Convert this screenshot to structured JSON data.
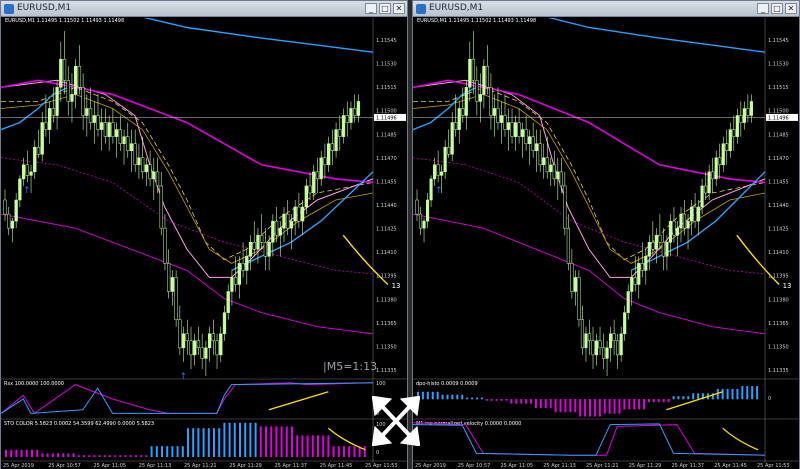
{
  "windows": [
    {
      "title": "EURUSD,M1",
      "header": "EURUSD,M1  1.11495 1.11502 1.11493 1.11498",
      "price_labels": [
        "1.11545",
        "1.11530",
        "1.11515",
        "1.11500",
        "1.11485",
        "1.11470",
        "1.11455",
        "1.11440",
        "1.11425",
        "1.11410",
        "1.11395",
        "1.11380",
        "1.11365",
        "1.11350",
        "1.11335"
      ],
      "current_price": "1.11496",
      "marker": "13",
      "note": "|M5=1:13",
      "panel1": {
        "title": "Rsx 100.0000 100.0000",
        "scale": [
          "100",
          "",
          "0"
        ]
      },
      "panel2": {
        "title": "STO COLOR 5.5823  0.0002 54.3599 62.4990  0.0000  5.5823",
        "scale": [
          "100",
          "50",
          "0"
        ]
      },
      "time_labels": [
        "25 Apr 2019",
        "25 Apr 10:57",
        "25 Apr 11:05",
        "25 Apr 11:13",
        "25 Apr 11:21",
        "25 Apr 11:29",
        "25 Apr 11:37",
        "25 Apr 11:45",
        "25 Apr 11:53"
      ]
    },
    {
      "title": "EURUSD,M1",
      "header": "EURUSD,M1  1.11495 1.11502 1.11493 1.11498",
      "price_labels": [
        "1.11545",
        "1.11530",
        "1.11515",
        "1.11500",
        "1.11485",
        "1.11470",
        "1.11455",
        "1.11440",
        "1.11425",
        "1.11410",
        "1.11395",
        "1.11380",
        "1.11365",
        "1.11350",
        "1.11335"
      ],
      "current_price": "1.11496",
      "marker": "13",
      "panel1": {
        "title": "dpo-histo 0.0009 0.0009",
        "scale": [
          "",
          "0",
          ""
        ]
      },
      "panel2": {
        "title": "M1 rsx normalized velocity 0.0000 0.0000",
        "scale": [
          "",
          "",
          ""
        ]
      },
      "time_labels": [
        "25 Apr 2019",
        "25 Apr 10:57",
        "25 Apr 11:05",
        "25 Apr 11:13",
        "25 Apr 11:21",
        "25 Apr 11:29",
        "25 Apr 11:37",
        "25 Apr 11:45",
        "25 Apr 11:53"
      ]
    }
  ],
  "buttons": {
    "minimize": "_",
    "maximize": "□",
    "close": "✕"
  },
  "colors": {
    "bg": "#000000",
    "candle": "#c8ff9e",
    "blue": "#2aa0ff",
    "magenta": "#e000e0",
    "pink": "#ff9de8",
    "gold": "#c8a000",
    "yellow": "#ffe000",
    "histo_blue": "#2aa0ff",
    "histo_magenta": "#e000e0"
  },
  "candles": [
    [
      0.0,
      0.5,
      0.53,
      0.44,
      0.46
    ],
    [
      0.01,
      0.46,
      0.48,
      0.4,
      0.42
    ],
    [
      0.02,
      0.42,
      0.45,
      0.38,
      0.44
    ],
    [
      0.03,
      0.44,
      0.52,
      0.42,
      0.5
    ],
    [
      0.04,
      0.5,
      0.57,
      0.48,
      0.56
    ],
    [
      0.05,
      0.56,
      0.62,
      0.54,
      0.6
    ],
    [
      0.06,
      0.6,
      0.64,
      0.55,
      0.57
    ],
    [
      0.07,
      0.57,
      0.6,
      0.52,
      0.58
    ],
    [
      0.08,
      0.58,
      0.67,
      0.56,
      0.65
    ],
    [
      0.09,
      0.65,
      0.7,
      0.62,
      0.63
    ],
    [
      0.1,
      0.63,
      0.75,
      0.61,
      0.72
    ],
    [
      0.11,
      0.72,
      0.8,
      0.68,
      0.7
    ],
    [
      0.12,
      0.7,
      0.78,
      0.66,
      0.76
    ],
    [
      0.13,
      0.76,
      0.82,
      0.72,
      0.74
    ],
    [
      0.14,
      0.74,
      0.84,
      0.7,
      0.82
    ],
    [
      0.15,
      0.82,
      0.95,
      0.78,
      0.9
    ],
    [
      0.16,
      0.9,
      0.98,
      0.8,
      0.84
    ],
    [
      0.17,
      0.84,
      0.88,
      0.74,
      0.78
    ],
    [
      0.18,
      0.78,
      0.86,
      0.72,
      0.8
    ],
    [
      0.19,
      0.8,
      0.9,
      0.76,
      0.88
    ],
    [
      0.2,
      0.88,
      0.94,
      0.8,
      0.82
    ],
    [
      0.21,
      0.82,
      0.86,
      0.7,
      0.74
    ],
    [
      0.22,
      0.74,
      0.8,
      0.68,
      0.76
    ],
    [
      0.23,
      0.76,
      0.82,
      0.7,
      0.72
    ],
    [
      0.24,
      0.72,
      0.78,
      0.66,
      0.74
    ],
    [
      0.25,
      0.74,
      0.8,
      0.68,
      0.7
    ],
    [
      0.26,
      0.7,
      0.76,
      0.64,
      0.72
    ],
    [
      0.27,
      0.72,
      0.76,
      0.66,
      0.68
    ],
    [
      0.28,
      0.68,
      0.74,
      0.64,
      0.72
    ],
    [
      0.29,
      0.72,
      0.76,
      0.66,
      0.68
    ],
    [
      0.3,
      0.68,
      0.72,
      0.62,
      0.7
    ],
    [
      0.31,
      0.7,
      0.74,
      0.64,
      0.66
    ],
    [
      0.32,
      0.66,
      0.7,
      0.6,
      0.68
    ],
    [
      0.33,
      0.68,
      0.72,
      0.62,
      0.64
    ],
    [
      0.34,
      0.64,
      0.7,
      0.58,
      0.66
    ],
    [
      0.35,
      0.66,
      0.7,
      0.58,
      0.6
    ],
    [
      0.36,
      0.6,
      0.66,
      0.56,
      0.62
    ],
    [
      0.37,
      0.62,
      0.68,
      0.56,
      0.58
    ],
    [
      0.38,
      0.58,
      0.62,
      0.54,
      0.6
    ],
    [
      0.39,
      0.6,
      0.64,
      0.54,
      0.56
    ],
    [
      0.4,
      0.56,
      0.62,
      0.5,
      0.58
    ],
    [
      0.41,
      0.58,
      0.62,
      0.52,
      0.54
    ],
    [
      0.42,
      0.54,
      0.58,
      0.4,
      0.42
    ],
    [
      0.43,
      0.42,
      0.46,
      0.3,
      0.32
    ],
    [
      0.44,
      0.32,
      0.36,
      0.22,
      0.24
    ],
    [
      0.45,
      0.24,
      0.3,
      0.2,
      0.28
    ],
    [
      0.46,
      0.28,
      0.3,
      0.14,
      0.16
    ],
    [
      0.47,
      0.16,
      0.2,
      0.06,
      0.08
    ],
    [
      0.48,
      0.08,
      0.14,
      0.04,
      0.12
    ],
    [
      0.49,
      0.12,
      0.16,
      0.06,
      0.1
    ],
    [
      0.5,
      0.1,
      0.14,
      0.02,
      0.06
    ],
    [
      0.51,
      0.06,
      0.12,
      0.03,
      0.1
    ],
    [
      0.52,
      0.1,
      0.14,
      0.06,
      0.08
    ],
    [
      0.53,
      0.08,
      0.12,
      0.02,
      0.05
    ],
    [
      0.54,
      0.05,
      0.1,
      0.0,
      0.08
    ],
    [
      0.55,
      0.08,
      0.14,
      0.04,
      0.12
    ],
    [
      0.56,
      0.12,
      0.16,
      0.06,
      0.1
    ],
    [
      0.57,
      0.1,
      0.12,
      0.02,
      0.06
    ],
    [
      0.58,
      0.06,
      0.14,
      0.04,
      0.12
    ],
    [
      0.59,
      0.12,
      0.2,
      0.1,
      0.18
    ],
    [
      0.6,
      0.18,
      0.26,
      0.16,
      0.24
    ],
    [
      0.61,
      0.24,
      0.3,
      0.2,
      0.28
    ],
    [
      0.62,
      0.28,
      0.34,
      0.24,
      0.26
    ],
    [
      0.63,
      0.26,
      0.34,
      0.22,
      0.32
    ],
    [
      0.64,
      0.32,
      0.38,
      0.28,
      0.3
    ],
    [
      0.65,
      0.3,
      0.36,
      0.26,
      0.34
    ],
    [
      0.66,
      0.34,
      0.4,
      0.3,
      0.38
    ],
    [
      0.67,
      0.38,
      0.44,
      0.34,
      0.36
    ],
    [
      0.68,
      0.36,
      0.42,
      0.32,
      0.4
    ],
    [
      0.69,
      0.4,
      0.46,
      0.36,
      0.38
    ],
    [
      0.7,
      0.38,
      0.42,
      0.3,
      0.34
    ],
    [
      0.71,
      0.34,
      0.4,
      0.3,
      0.38
    ],
    [
      0.72,
      0.38,
      0.46,
      0.34,
      0.44
    ],
    [
      0.73,
      0.44,
      0.48,
      0.38,
      0.4
    ],
    [
      0.74,
      0.4,
      0.44,
      0.34,
      0.42
    ],
    [
      0.75,
      0.42,
      0.48,
      0.38,
      0.46
    ],
    [
      0.76,
      0.46,
      0.5,
      0.4,
      0.42
    ],
    [
      0.77,
      0.42,
      0.46,
      0.36,
      0.44
    ],
    [
      0.78,
      0.44,
      0.5,
      0.4,
      0.48
    ],
    [
      0.79,
      0.48,
      0.52,
      0.42,
      0.44
    ],
    [
      0.8,
      0.44,
      0.5,
      0.4,
      0.48
    ],
    [
      0.81,
      0.48,
      0.56,
      0.46,
      0.54
    ],
    [
      0.82,
      0.54,
      0.58,
      0.5,
      0.52
    ],
    [
      0.83,
      0.52,
      0.6,
      0.5,
      0.58
    ],
    [
      0.84,
      0.58,
      0.62,
      0.52,
      0.56
    ],
    [
      0.85,
      0.56,
      0.64,
      0.54,
      0.62
    ],
    [
      0.86,
      0.62,
      0.66,
      0.56,
      0.6
    ],
    [
      0.87,
      0.6,
      0.68,
      0.58,
      0.66
    ],
    [
      0.88,
      0.66,
      0.7,
      0.6,
      0.64
    ],
    [
      0.89,
      0.64,
      0.72,
      0.62,
      0.7
    ],
    [
      0.9,
      0.7,
      0.74,
      0.64,
      0.68
    ],
    [
      0.91,
      0.68,
      0.76,
      0.66,
      0.74
    ],
    [
      0.92,
      0.74,
      0.78,
      0.68,
      0.72
    ],
    [
      0.93,
      0.72,
      0.78,
      0.7,
      0.76
    ],
    [
      0.94,
      0.76,
      0.8,
      0.72,
      0.74
    ],
    [
      0.95,
      0.74,
      0.8,
      0.72,
      0.78
    ]
  ]
}
